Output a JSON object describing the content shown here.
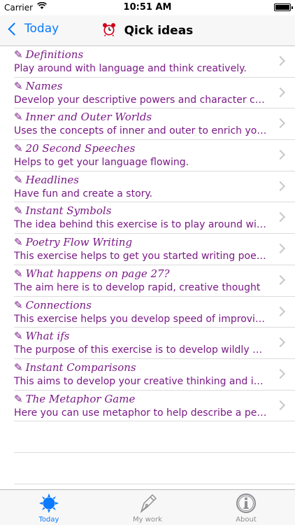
{
  "status_bar": {
    "carrier": "Carrier",
    "time": "10:51 AM"
  },
  "nav": {
    "back_label": "Today",
    "title": "Qick ideas",
    "title_icon": "alarm-clock-icon"
  },
  "colors": {
    "accent": "#0a7aff",
    "item_text": "#7a1a86"
  },
  "items": [
    {
      "title": "Definitions",
      "description": "Play around with language and think creatively."
    },
    {
      "title": "Names",
      "description": "Develop your descriptive powers and character creation skills"
    },
    {
      "title": "Inner and Outer Worlds",
      "description": "Uses the concepts of inner and outer to enrich your writing"
    },
    {
      "title": "20 Second Speeches",
      "description": "Helps to get your language flowing."
    },
    {
      "title": "Headlines",
      "description": "Have fun and create a story."
    },
    {
      "title": "Instant Symbols",
      "description": "The idea behind this exercise is to play around with symbols"
    },
    {
      "title": "Poetry Flow Writing",
      "description": "This exercise helps to get you started writing poetry"
    },
    {
      "title": "What happens on page 27?",
      "description": "The aim here is to develop rapid, creative thought"
    },
    {
      "title": "Connections",
      "description": "This exercise helps you develop speed of improvisation"
    },
    {
      "title": "What ifs",
      "description": "The purpose of this exercise is to develop wildly creative ideas"
    },
    {
      "title": "Instant Comparisons",
      "description": "This aims to develop your creative thinking and imagination"
    },
    {
      "title": "The Metaphor Game",
      "description": "Here you can use metaphor to help describe a person"
    }
  ],
  "tabs": [
    {
      "label": "Today",
      "icon": "sun-icon",
      "active": true
    },
    {
      "label": "My work",
      "icon": "pen-nib-icon",
      "active": false
    },
    {
      "label": "About",
      "icon": "info-icon",
      "active": false
    }
  ]
}
